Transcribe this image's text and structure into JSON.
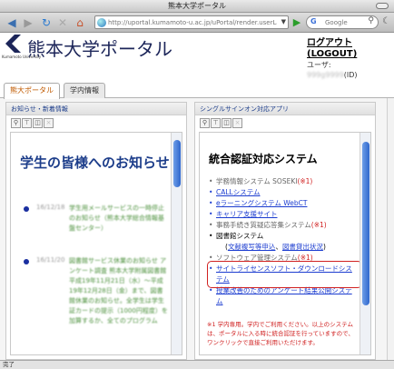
{
  "window": {
    "title": "熊本大学ポータル"
  },
  "toolbar": {
    "back_icon": "back-arrow-icon",
    "url_placeholder": "http://uportal.kumamoto-u.ac.jp/uPortal/render.userLayoutRootNode.uP",
    "search_placeholder": "Google"
  },
  "header": {
    "logo_text": "熊本大学ポータル",
    "logo_sub": "Kumamoto University",
    "logout_ja": "ログアウト",
    "logout_en": "(LOGOUT)",
    "user_label": "ユーザ:",
    "user_id": "999g9999",
    "user_suffix": "(ID)"
  },
  "tabs": [
    {
      "label": "熊大ポータル",
      "active": true
    },
    {
      "label": "学内情報",
      "active": false
    }
  ],
  "left_panel": {
    "heading": "お知らせ・新着情報",
    "banner": "学生の皆様へのお知らせ",
    "items": [
      {
        "date": "16/12/18",
        "text": "学生用メールサービスの一時停止のお知らせ（熊本大学総合情報基盤センター）"
      },
      {
        "date": "16/11/20",
        "text": "図書館サービス休業のお知らせ アンケート調査 熊本大学附属図書館 平成19年11月21日（水）〜平成19年12月28日（金）まで、図書館休業のお知らせ。全学生は学生証カードの提示（1000円程度）を加算するか、全てのプログラム"
      }
    ]
  },
  "right_panel": {
    "heading": "シングルサインオン対応アプリ",
    "title": "統合認証対応システム",
    "items": [
      {
        "label": "学務情報システム SOSEKI",
        "mark": "(※1)",
        "kind": "grey"
      },
      {
        "label": "CALLシステム",
        "kind": "link"
      },
      {
        "label": "eラーニングシステム WebCT",
        "kind": "link"
      },
      {
        "label": "キャリア支援サイト",
        "kind": "link"
      },
      {
        "label": "事務手続き質疑応答集システム",
        "mark": "(※1)",
        "kind": "grey"
      },
      {
        "label": "図書館システム",
        "kind": "black",
        "sub_a": "文献複写等申込",
        "sub_sep": "、",
        "sub_b": "図書貸出状況",
        "sub_open": "(",
        "sub_close": ")"
      },
      {
        "label": "ソフトウェア管理システム",
        "mark": "(※1)",
        "kind": "grey"
      },
      {
        "label": "サイトライセンスソフト・ダウンロードシステム",
        "kind": "link"
      },
      {
        "label": "授業改善のためのアンケート結果公開システム",
        "kind": "link"
      }
    ],
    "notice": "※1 学内専用。学内でご利用ください。以上のシステムは、ポータルに入る時に統合認証を行っていますので、ワンクリックで直接ご利用いただけます。"
  },
  "status": {
    "text": "完了"
  },
  "colors": {
    "brand": "#1c2559",
    "link": "#1c3dd0",
    "alert": "#d02020",
    "active_tab": "#c05a00"
  }
}
